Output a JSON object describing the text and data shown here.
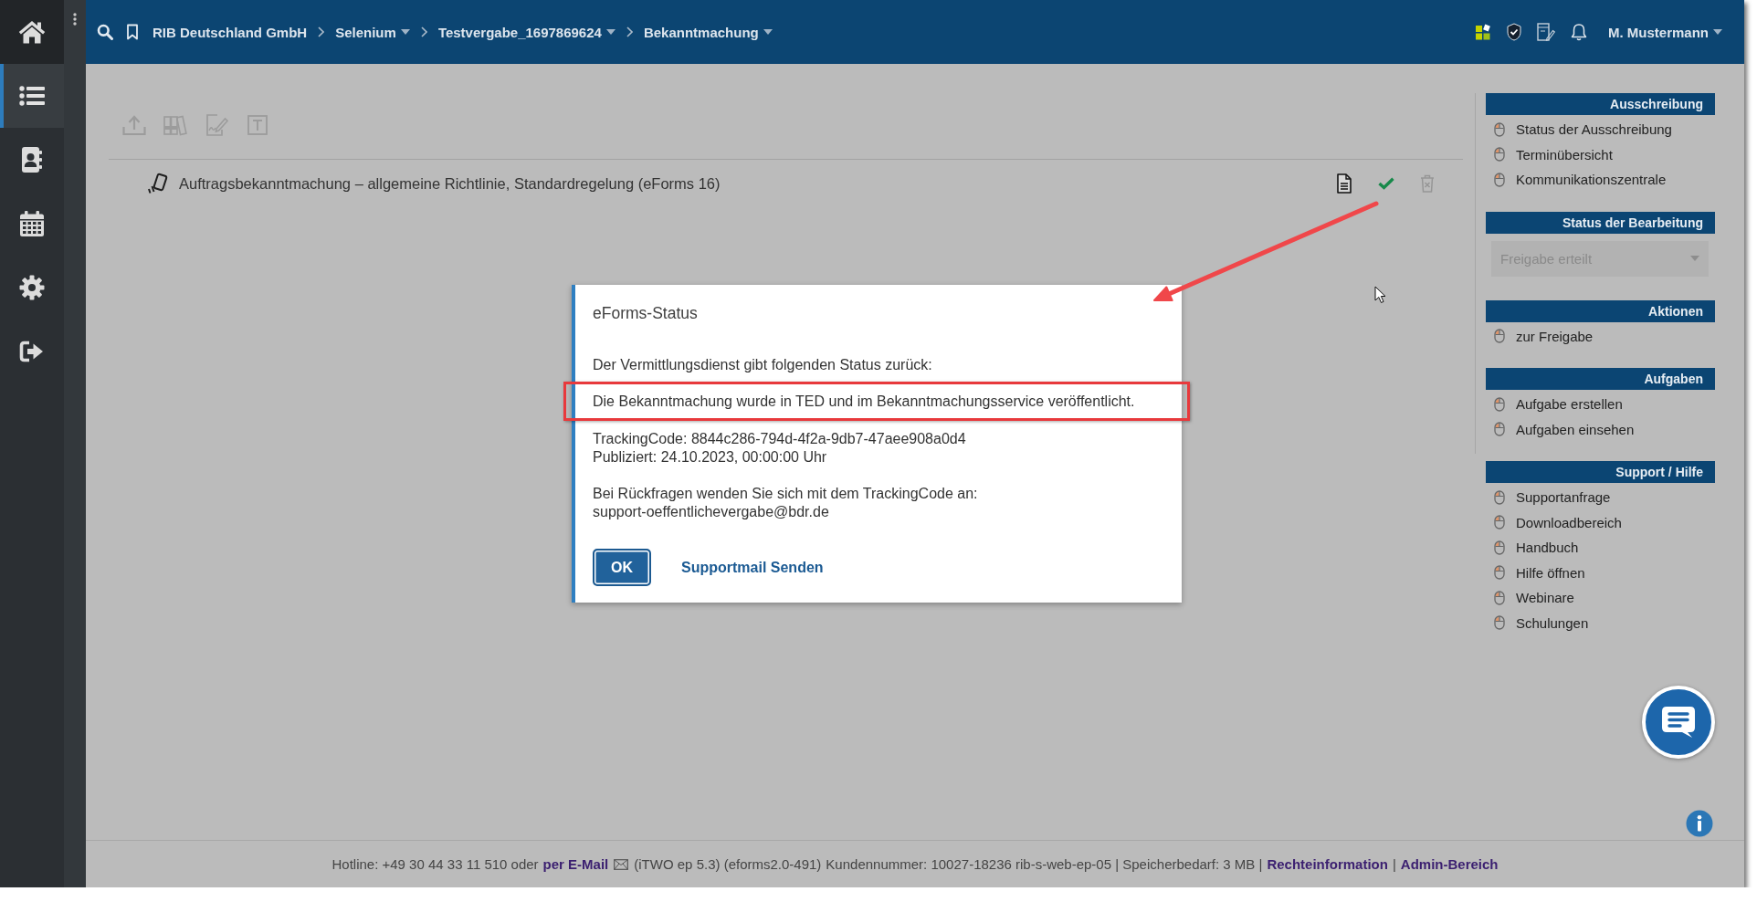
{
  "sidebar": {
    "items": [
      {
        "selected": true
      },
      {
        "selected": false
      },
      {
        "selected": false
      },
      {
        "selected": false
      },
      {
        "selected": false
      }
    ]
  },
  "breadcrumbs": [
    {
      "label": "RIB Deutschland GmbH",
      "dropdown": false
    },
    {
      "label": "Selenium",
      "dropdown": true
    },
    {
      "label": "Testvergabe_1697869624",
      "dropdown": true
    },
    {
      "label": "Bekanntmachung",
      "dropdown": true
    }
  ],
  "user_menu": {
    "label": "M. Mustermann"
  },
  "toolbar": {
    "buttons": [
      {
        "disabled": true
      },
      {
        "disabled": true
      },
      {
        "disabled": true
      },
      {
        "disabled": true
      }
    ]
  },
  "notices": [
    {
      "title": "Auftragsbekanntmachung – allgemeine Richtlinie, Standardregelung (eForms 16)",
      "released": true,
      "delete_disabled": true
    }
  ],
  "side_panel": {
    "groups": [
      {
        "sections": [
          {
            "title": "Ausschreibung",
            "kind": "links",
            "items": [
              "Status der Ausschreibung",
              "Terminübersicht",
              "Kommunikationszentrale"
            ]
          },
          {
            "title": "Status der Bearbeitung",
            "kind": "select",
            "value": "Freigabe erteilt",
            "disabled": true
          },
          {
            "title": "Aktionen",
            "kind": "links",
            "items": [
              "zur Freigabe"
            ]
          },
          {
            "title": "Aufgaben",
            "kind": "links",
            "items": [
              "Aufgabe erstellen",
              "Aufgaben einsehen"
            ]
          }
        ]
      },
      {
        "sections": [
          {
            "title": "Support / Hilfe",
            "kind": "links",
            "items": [
              "Supportanfrage",
              "Downloadbereich",
              "Handbuch",
              "Hilfe öffnen",
              "Webinare",
              "Schulungen"
            ]
          }
        ]
      }
    ]
  },
  "dialog": {
    "title": "eForms-Status",
    "intro": "Der Vermittlungsdienst gibt folgenden Status zurück:",
    "status_message": {
      "text": "Die Bekanntmachung wurde in TED und im Bekanntmachungsservice veröffentlicht.",
      "highlighted": true
    },
    "tracking_code": "TrackingCode: 8844c286-794d-4f2a-9db7-47aee908a0d4",
    "published": "Publiziert: 24.10.2023, 00:00:00 Uhr",
    "contact_hint": "Bei Rückfragen wenden Sie sich mit dem TrackingCode an:",
    "support_email": "support-oeffentlichevergabe@bdr.de",
    "buttons": [
      {
        "label": "OK",
        "kind": "primary"
      },
      {
        "label": "Supportmail Senden",
        "kind": "link"
      }
    ]
  },
  "footer": {
    "items": [
      {
        "kind": "text",
        "text": "Hotline: +49 30 44 33 11 510 oder"
      },
      {
        "kind": "email",
        "text": "per E-Mail"
      },
      {
        "kind": "text",
        "text": "(iTWO ep 5.3) (eforms2.0-491)"
      },
      {
        "kind": "text",
        "text": "Kundennummer: 10027-18236 rib-s-web-ep-05 | Speicherbedarf: 3 MB |"
      },
      {
        "kind": "link",
        "text": "Rechteinformation"
      },
      {
        "kind": "text",
        "text": "|"
      },
      {
        "kind": "link",
        "text": "Admin-Bereich"
      }
    ]
  }
}
